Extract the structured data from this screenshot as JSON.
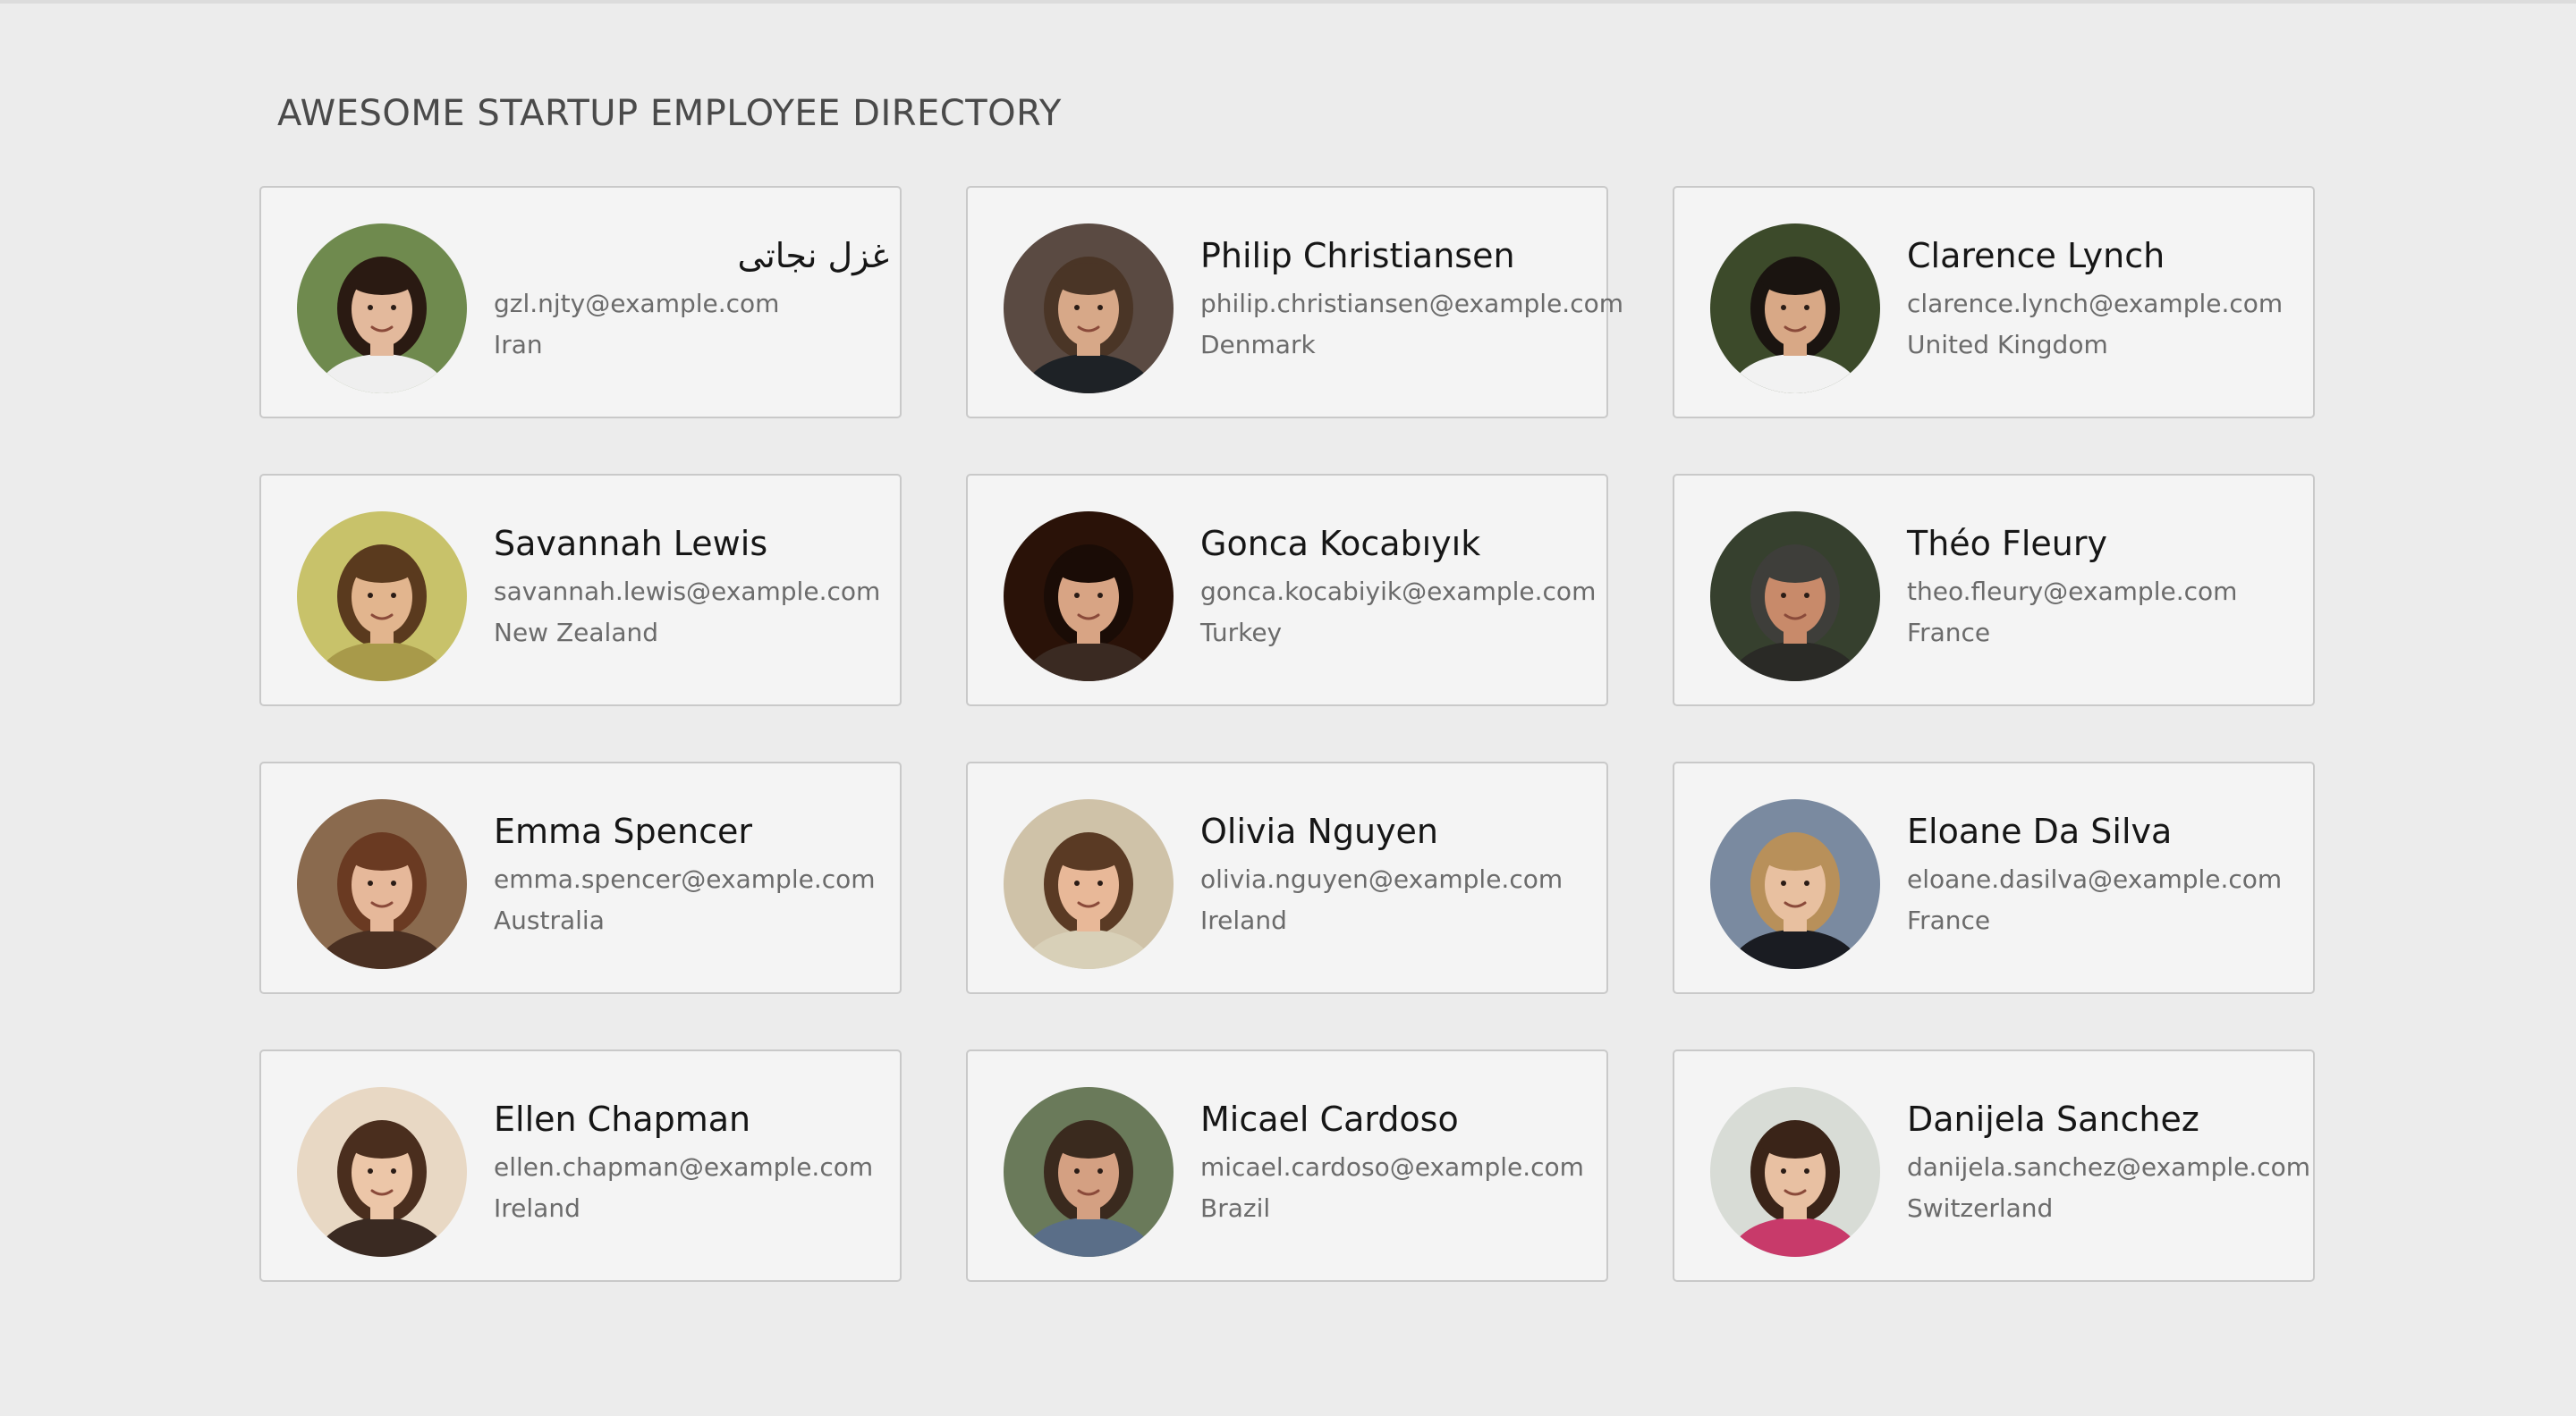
{
  "header": {
    "title": "AWESOME STARTUP EMPLOYEE DIRECTORY"
  },
  "employees": [
    {
      "name": "غزل نجاتی",
      "email": "gzl.njty@example.com",
      "country": "Iran",
      "photo": {
        "bg": "#6f8a4e",
        "hair": "#2a1a12",
        "skin": "#e3b99c",
        "shirt": "#efefef"
      }
    },
    {
      "name": "Philip Christiansen",
      "email": "philip.christiansen@example.com",
      "country": "Denmark",
      "photo": {
        "bg": "#5a4a42",
        "hair": "#4a3526",
        "skin": "#d7a888",
        "shirt": "#1e2226"
      }
    },
    {
      "name": "Clarence Lynch",
      "email": "clarence.lynch@example.com",
      "country": "United Kingdom",
      "photo": {
        "bg": "#3c4a2a",
        "hair": "#1a1410",
        "skin": "#d8a886",
        "shirt": "#f2f2f2"
      }
    },
    {
      "name": "Savannah Lewis",
      "email": "savannah.lewis@example.com",
      "country": "New Zealand",
      "photo": {
        "bg": "#c8c26a",
        "hair": "#5a3a1e",
        "skin": "#e2b58e",
        "shirt": "#a89a4a"
      }
    },
    {
      "name": "Gonca Kocabıyık",
      "email": "gonca.kocabiyik@example.com",
      "country": "Turkey",
      "photo": {
        "bg": "#2a1208",
        "hair": "#1a0c06",
        "skin": "#d8a484",
        "shirt": "#3a2a22"
      }
    },
    {
      "name": "Théo Fleury",
      "email": "theo.fleury@example.com",
      "country": "France",
      "photo": {
        "bg": "#36402e",
        "hair": "#3e3e3a",
        "skin": "#c88a6a",
        "shirt": "#2a2a26"
      }
    },
    {
      "name": "Emma Spencer",
      "email": "emma.spencer@example.com",
      "country": "Australia",
      "photo": {
        "bg": "#8a6a4e",
        "hair": "#6a3a22",
        "skin": "#e6b89a",
        "shirt": "#4a3022"
      }
    },
    {
      "name": "Olivia Nguyen",
      "email": "olivia.nguyen@example.com",
      "country": "Ireland",
      "photo": {
        "bg": "#cfc2a8",
        "hair": "#5a3a24",
        "skin": "#e8b898",
        "shirt": "#d8d0b8"
      }
    },
    {
      "name": "Eloane Da Silva",
      "email": "eloane.dasilva@example.com",
      "country": "France",
      "photo": {
        "bg": "#7a8aa0",
        "hair": "#b8905a",
        "skin": "#e8c0a0",
        "shirt": "#1a1c22"
      }
    },
    {
      "name": "Ellen Chapman",
      "email": "ellen.chapman@example.com",
      "country": "Ireland",
      "photo": {
        "bg": "#e8d8c4",
        "hair": "#4a2e1e",
        "skin": "#ecc6a8",
        "shirt": "#3a2a22"
      }
    },
    {
      "name": "Micael Cardoso",
      "email": "micael.cardoso@example.com",
      "country": "Brazil",
      "photo": {
        "bg": "#6a7a5a",
        "hair": "#3a2a1e",
        "skin": "#d4a082",
        "shirt": "#5a6e88"
      }
    },
    {
      "name": "Danijela Sanchez",
      "email": "danijela.sanchez@example.com",
      "country": "Switzerland",
      "photo": {
        "bg": "#d8dcd6",
        "hair": "#3a2418",
        "skin": "#e8c0a2",
        "shirt": "#c83a6a"
      }
    }
  ]
}
